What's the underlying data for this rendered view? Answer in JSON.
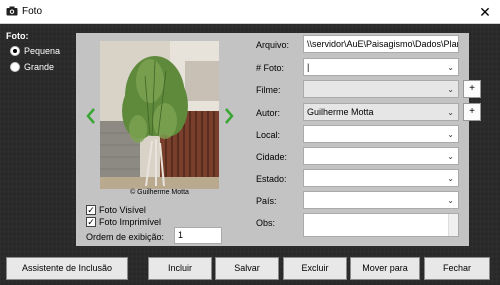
{
  "window": {
    "title": "Foto",
    "close_glyph": "✕"
  },
  "size_group": {
    "heading": "Foto:",
    "options": [
      {
        "label": "Pequena",
        "selected": true
      },
      {
        "label": "Grande",
        "selected": false
      }
    ]
  },
  "photo": {
    "caption": "© Guilherme Motta"
  },
  "checkboxes": [
    {
      "label": "Foto Visível",
      "checked": true
    },
    {
      "label": "Foto Imprimível",
      "checked": true
    }
  ],
  "order": {
    "label": "Ordem de exibição:",
    "value": "1"
  },
  "fields": {
    "arquivo": {
      "label": "Arquivo:",
      "value": "\\\\servidor\\AuE\\Paisagismo\\Dados\\Planta"
    },
    "foto_num": {
      "label": "# Foto:",
      "value": "|"
    },
    "filme": {
      "label": "Filme:",
      "value": ""
    },
    "autor": {
      "label": "Autor:",
      "value": "Guilherme Motta"
    },
    "local": {
      "label": "Local:",
      "value": ""
    },
    "cidade": {
      "label": "Cidade:",
      "value": ""
    },
    "estado": {
      "label": "Estado:",
      "value": ""
    },
    "pais": {
      "label": "País:",
      "value": ""
    },
    "obs": {
      "label": "Obs:",
      "value": ""
    }
  },
  "plus_glyph": "+",
  "chevron_glyph": "⌄",
  "check_glyph": "✓",
  "buttons": {
    "assistente": "Assistente de Inclusão",
    "incluir": "Incluir",
    "salvar": "Salvar",
    "excluir": "Excluir",
    "mover": "Mover para",
    "fechar": "Fechar"
  },
  "colors": {
    "nav_arrow": "#3aa635",
    "panel": "#c3c3c3"
  }
}
